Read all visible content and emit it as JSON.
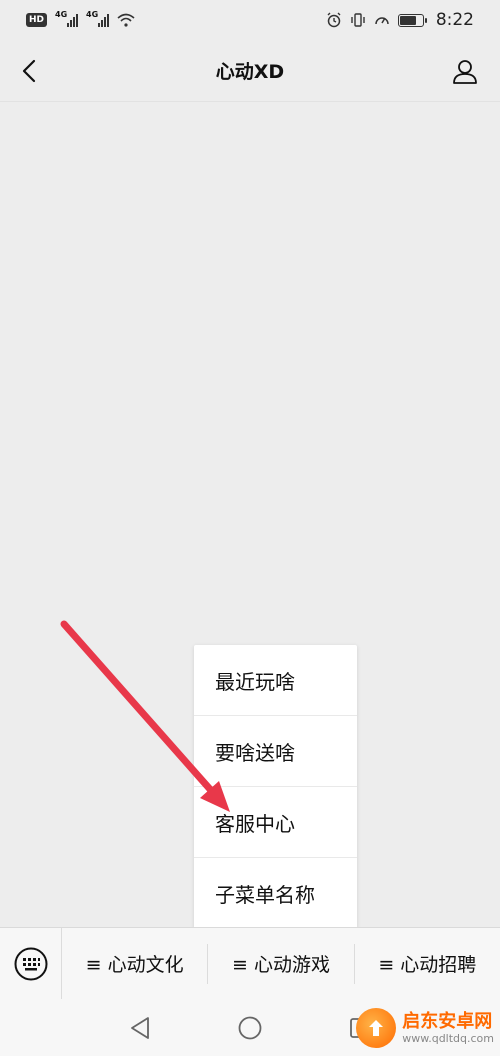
{
  "status_bar": {
    "hd_label": "HD",
    "signal1_label": "4G",
    "signal2_label": "4G",
    "battery_level": 0.75,
    "time": "8:22"
  },
  "nav": {
    "title": "心动XD"
  },
  "submenu": {
    "items": [
      "最近玩啥",
      "要啥送啥",
      "客服中心",
      "子菜单名称"
    ]
  },
  "menu_bar": {
    "items": [
      {
        "label": "≡ 心动文化"
      },
      {
        "label": "≡ 心动游戏"
      },
      {
        "label": "≡ 心动招聘"
      }
    ]
  },
  "annotation": {
    "arrow_color": "#e8384a"
  },
  "watermark": {
    "name": "启东安卓网",
    "url": "www.qdltdq.com"
  }
}
